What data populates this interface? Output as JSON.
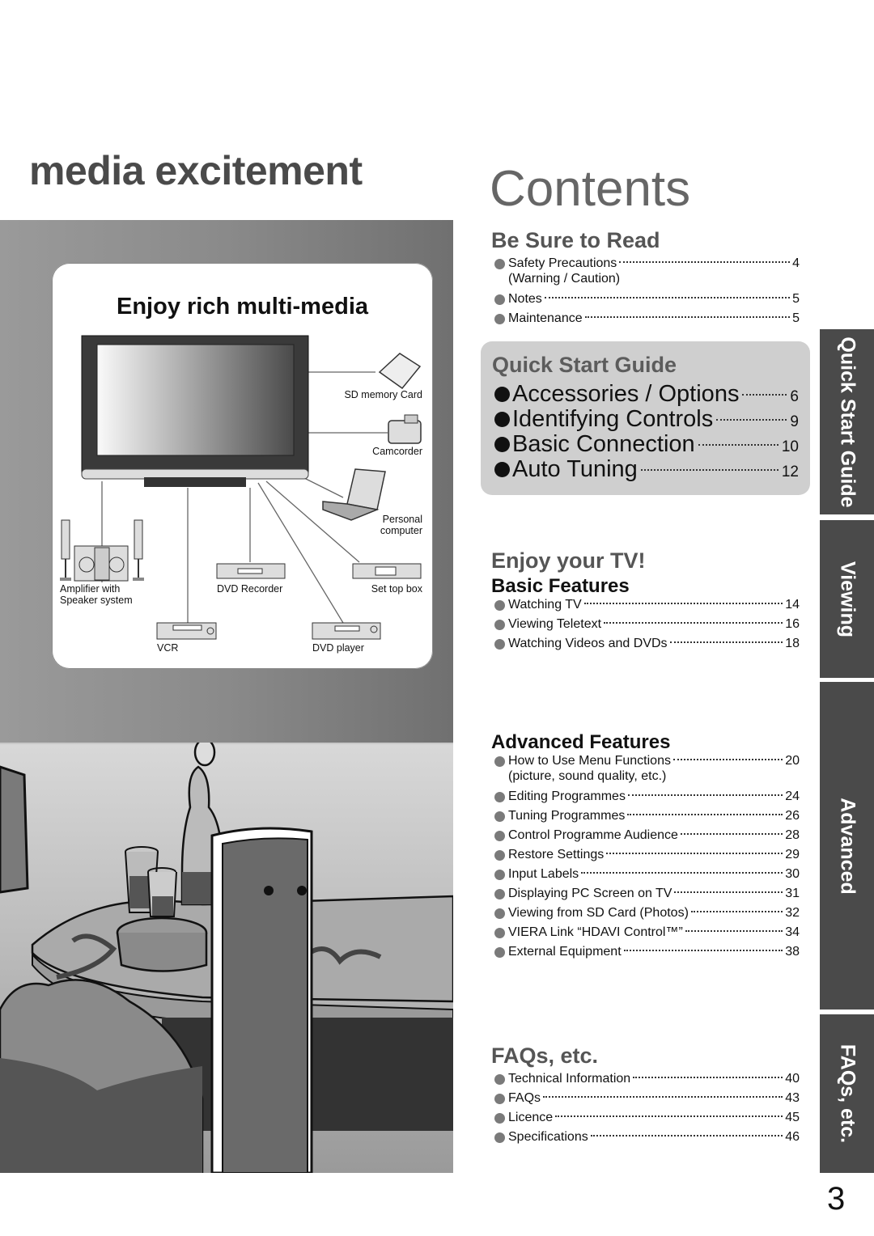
{
  "left": {
    "headline": "media excitement",
    "card_title": "Enjoy rich multi-media",
    "devices": [
      {
        "label": "SD memory Card",
        "icon": "sd-card-icon"
      },
      {
        "label": "Camcorder",
        "icon": "camcorder-icon"
      },
      {
        "label": "Personal computer",
        "icon": "laptop-icon"
      },
      {
        "label": "Amplifier with Speaker system",
        "icon": "amplifier-speaker-icon"
      },
      {
        "label": "DVD Recorder",
        "icon": "dvd-recorder-icon"
      },
      {
        "label": "Set top box",
        "icon": "set-top-box-icon"
      },
      {
        "label": "VCR",
        "icon": "vcr-icon"
      },
      {
        "label": "DVD player",
        "icon": "dvd-player-icon"
      }
    ],
    "device_labels": {
      "sd": "SD memory Card",
      "camcorder": "Camcorder",
      "pc1": "Personal",
      "pc2": "computer",
      "amp1": "Amplifier with",
      "amp2": "Speaker system",
      "dvdrec": "DVD Recorder",
      "stb": "Set top box",
      "vcr": "VCR",
      "dvdplayer": "DVD player"
    }
  },
  "contents": {
    "title": "Contents",
    "be_sure": {
      "heading": "Be Sure to Read",
      "items": [
        {
          "label": "Safety Precautions",
          "page": "4",
          "continuation": "(Warning / Caution)"
        },
        {
          "label": "Notes",
          "page": "5"
        },
        {
          "label": "Maintenance",
          "page": "5"
        }
      ]
    },
    "quick_start": {
      "heading": "Quick Start Guide",
      "items": [
        {
          "label": "Accessories / Options",
          "page": "6"
        },
        {
          "label": "Identifying Controls",
          "page": "9"
        },
        {
          "label": "Basic Connection",
          "page": "10"
        },
        {
          "label": "Auto Tuning",
          "page": "12"
        }
      ]
    },
    "enjoy": {
      "heading": "Enjoy your TV!",
      "basic": {
        "heading": "Basic Features",
        "items": [
          {
            "label": "Watching TV",
            "page": "14"
          },
          {
            "label": "Viewing Teletext",
            "page": "16"
          },
          {
            "label": "Watching Videos and DVDs",
            "page": "18"
          }
        ]
      },
      "advanced": {
        "heading": "Advanced Features",
        "items": [
          {
            "label": "How to Use Menu Functions",
            "page": "20",
            "continuation": "(picture, sound quality, etc.)"
          },
          {
            "label": "Editing Programmes",
            "page": "24"
          },
          {
            "label": "Tuning Programmes",
            "page": "26"
          },
          {
            "label": "Control Programme Audience",
            "page": "28"
          },
          {
            "label": "Restore Settings",
            "page": "29"
          },
          {
            "label": "Input Labels",
            "page": "30"
          },
          {
            "label": "Displaying PC Screen on TV",
            "page": "31"
          },
          {
            "label": "Viewing from SD Card (Photos)",
            "page": "32"
          },
          {
            "label": "VIERA Link “HDAVI Control™”",
            "page": "34"
          },
          {
            "label": "External Equipment",
            "page": "38"
          }
        ]
      }
    },
    "faqs": {
      "heading": "FAQs, etc.",
      "items": [
        {
          "label": "Technical Information",
          "page": "40"
        },
        {
          "label": "FAQs",
          "page": "43"
        },
        {
          "label": "Licence",
          "page": "45"
        },
        {
          "label": "Specifications",
          "page": "46"
        }
      ]
    }
  },
  "side_tabs": [
    {
      "label": "Quick Start Guide"
    },
    {
      "label": "Viewing"
    },
    {
      "label": "Advanced"
    },
    {
      "label": "FAQs, etc."
    }
  ],
  "page_number": "3",
  "colors": {
    "heading_gray": "#555555",
    "tab_dark": "#4a4a4a",
    "quick_box": "#cfcfcf",
    "bullet_gray": "#7a7a7a"
  }
}
